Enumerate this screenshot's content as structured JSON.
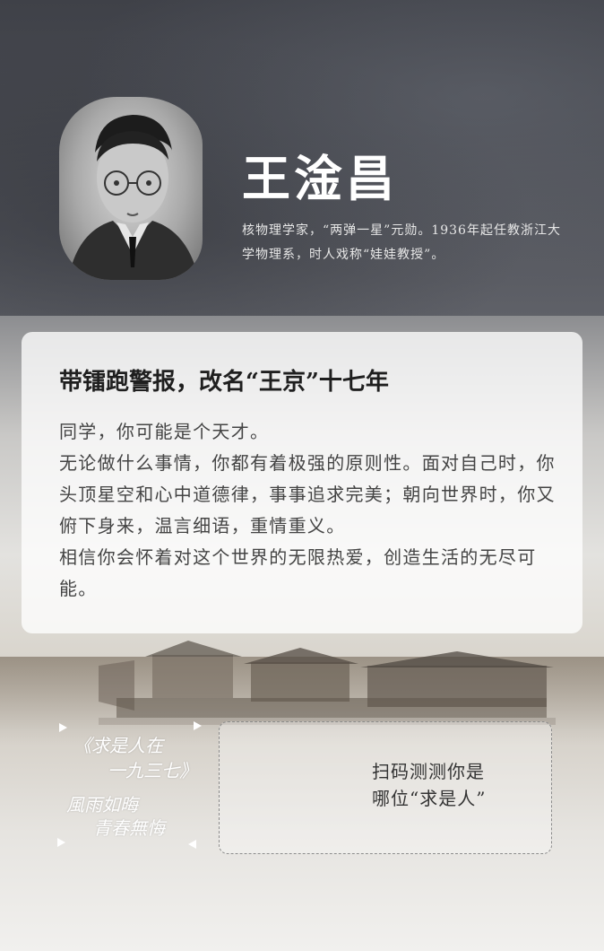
{
  "header": {
    "name": "王淦昌",
    "intro": "核物理学家，“两弹一星”元勋。1936年起任教浙江大学物理系，时人戏称“娃娃教授”。"
  },
  "card": {
    "title": "带镭跑警报，改名“王京”十七年",
    "paragraphs": [
      "同学，你可能是个天才。",
      "无论做什么事情，你都有着极强的原则性。面对自己时，你头顶星空和心中道德律，事事追求完美；朝向世界时，你又俯下身来，温言细语，重情重义。",
      "相信你会怀着对这个世界的无限热爱，创造生活的无尽可能。"
    ]
  },
  "poem": {
    "lines": [
      "《求是人在",
      "一九三七》",
      "風雨如晦",
      "青春無悔"
    ]
  },
  "scan": {
    "line1": "扫码测测你是",
    "line2": "哪位“求是人”"
  },
  "colors": {
    "header_bg": "#4a4c53",
    "card_bg": "#ffffff",
    "title_text": "#1f1f1f",
    "body_text": "#444444"
  }
}
